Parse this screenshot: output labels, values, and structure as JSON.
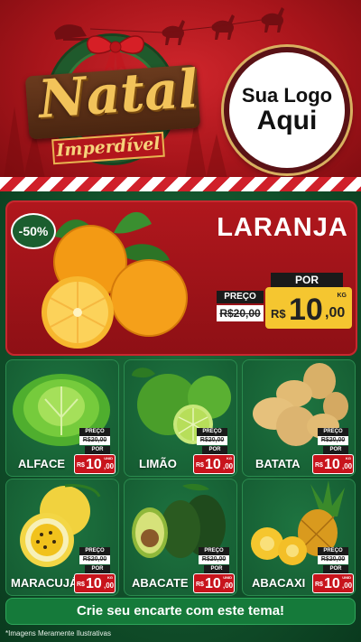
{
  "header": {
    "title": "Natal",
    "subtitle": "Imperdível",
    "logo_line1": "Sua Logo",
    "logo_line2": "Aqui"
  },
  "featured": {
    "discount": "-50%",
    "name": "LARANJA",
    "preco_label": "PREÇO",
    "old_price": "R$20,00",
    "por_label": "POR",
    "currency": "R$",
    "price_int": "10",
    "price_dec": ",00",
    "unit": "KG"
  },
  "products": [
    {
      "name": "ALFACE",
      "preco_label": "PREÇO",
      "old_price": "R$20,00",
      "por_label": "POR",
      "currency": "R$",
      "price_int": "10",
      "price_dec": ",00",
      "unit": "UNID"
    },
    {
      "name": "LIMÃO",
      "preco_label": "PREÇO",
      "old_price": "R$20,00",
      "por_label": "POR",
      "currency": "R$",
      "price_int": "10",
      "price_dec": ",00",
      "unit": "KG"
    },
    {
      "name": "BATATA",
      "preco_label": "PREÇO",
      "old_price": "R$20,00",
      "por_label": "POR",
      "currency": "R$",
      "price_int": "10",
      "price_dec": ",00",
      "unit": "KG"
    },
    {
      "name": "MARACUJÁ",
      "preco_label": "PREÇO",
      "old_price": "R$20,00",
      "por_label": "POR",
      "currency": "R$",
      "price_int": "10",
      "price_dec": ",00",
      "unit": "KG"
    },
    {
      "name": "ABACATE",
      "preco_label": "PREÇO",
      "old_price": "R$20,00",
      "por_label": "POR",
      "currency": "R$",
      "price_int": "10",
      "price_dec": ",00",
      "unit": "UNID"
    },
    {
      "name": "ABACAXI",
      "preco_label": "PREÇO",
      "old_price": "R$20,00",
      "por_label": "POR",
      "currency": "R$",
      "price_int": "10",
      "price_dec": ",00",
      "unit": "UNID"
    }
  ],
  "cta": "Crie seu encarte com este tema!",
  "footnote": "*Imagens Meramente Ilustrativas",
  "colors": {
    "red": "#b0171d",
    "green": "#145a31",
    "yellow": "#f5c630",
    "gold": "#f2c35a"
  }
}
